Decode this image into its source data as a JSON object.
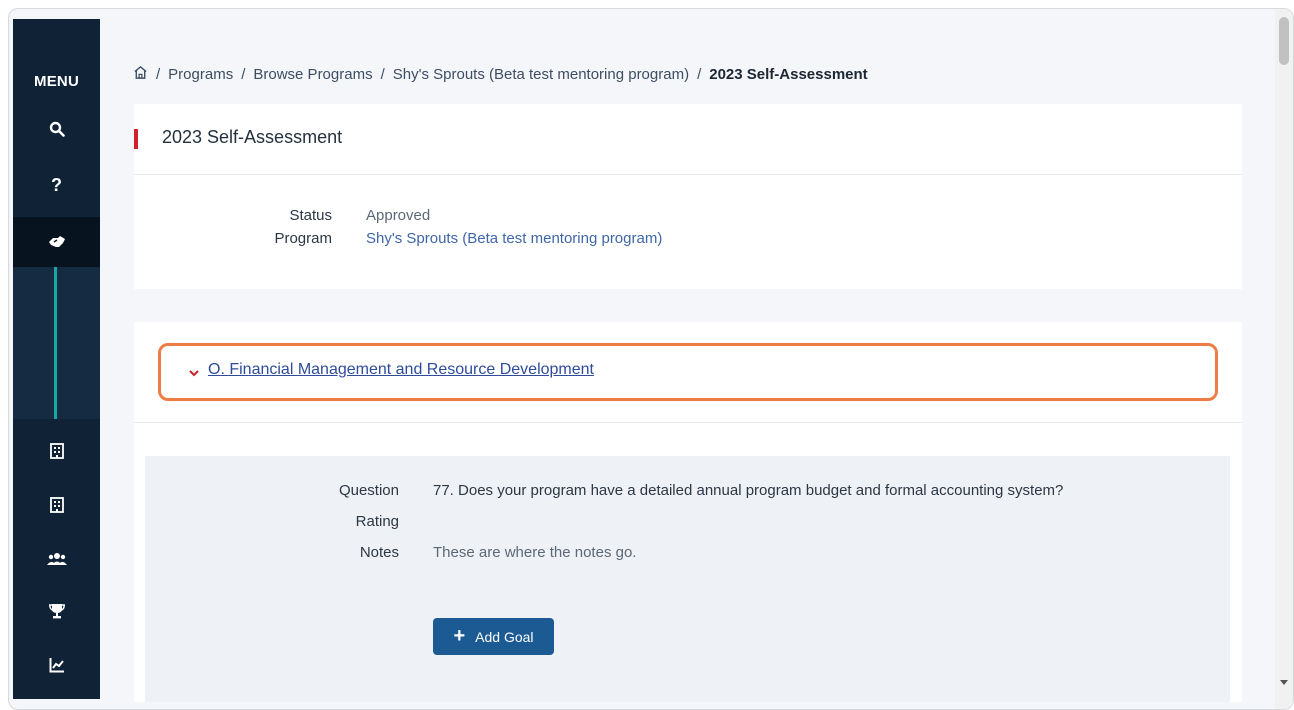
{
  "sidebar": {
    "menu_label": "MENU",
    "icons": [
      "search-icon",
      "help-icon",
      "handshake-icon",
      "building-icon",
      "building-icon",
      "users-icon",
      "trophy-icon",
      "chart-icon"
    ]
  },
  "breadcrumb": {
    "items": [
      "Programs",
      "Browse Programs",
      "Shy's Sprouts (Beta test mentoring program)"
    ],
    "current": "2023 Self-Assessment",
    "separator": "/"
  },
  "assessment": {
    "title": "2023 Self-Assessment",
    "status_label": "Status",
    "status_value": "Approved",
    "program_label": "Program",
    "program_value": "Shy's Sprouts (Beta test mentoring program)"
  },
  "section": {
    "title": "O. Financial Management and Resource Development"
  },
  "question": {
    "question_label": "Question",
    "question_value": "77. Does your program have a detailed annual program budget and formal accounting system?",
    "rating_label": "Rating",
    "rating_value": "",
    "notes_label": "Notes",
    "notes_value": "These are where the notes go.",
    "add_goal_label": "Add Goal"
  },
  "colors": {
    "sidebar_bg": "#0f2236",
    "accent_red": "#d0202a",
    "highlight_orange": "#ee7d45",
    "link_blue": "#2e4c9b",
    "button_blue": "#1c5a93",
    "sub_nav_teal": "#1ba5a5"
  }
}
